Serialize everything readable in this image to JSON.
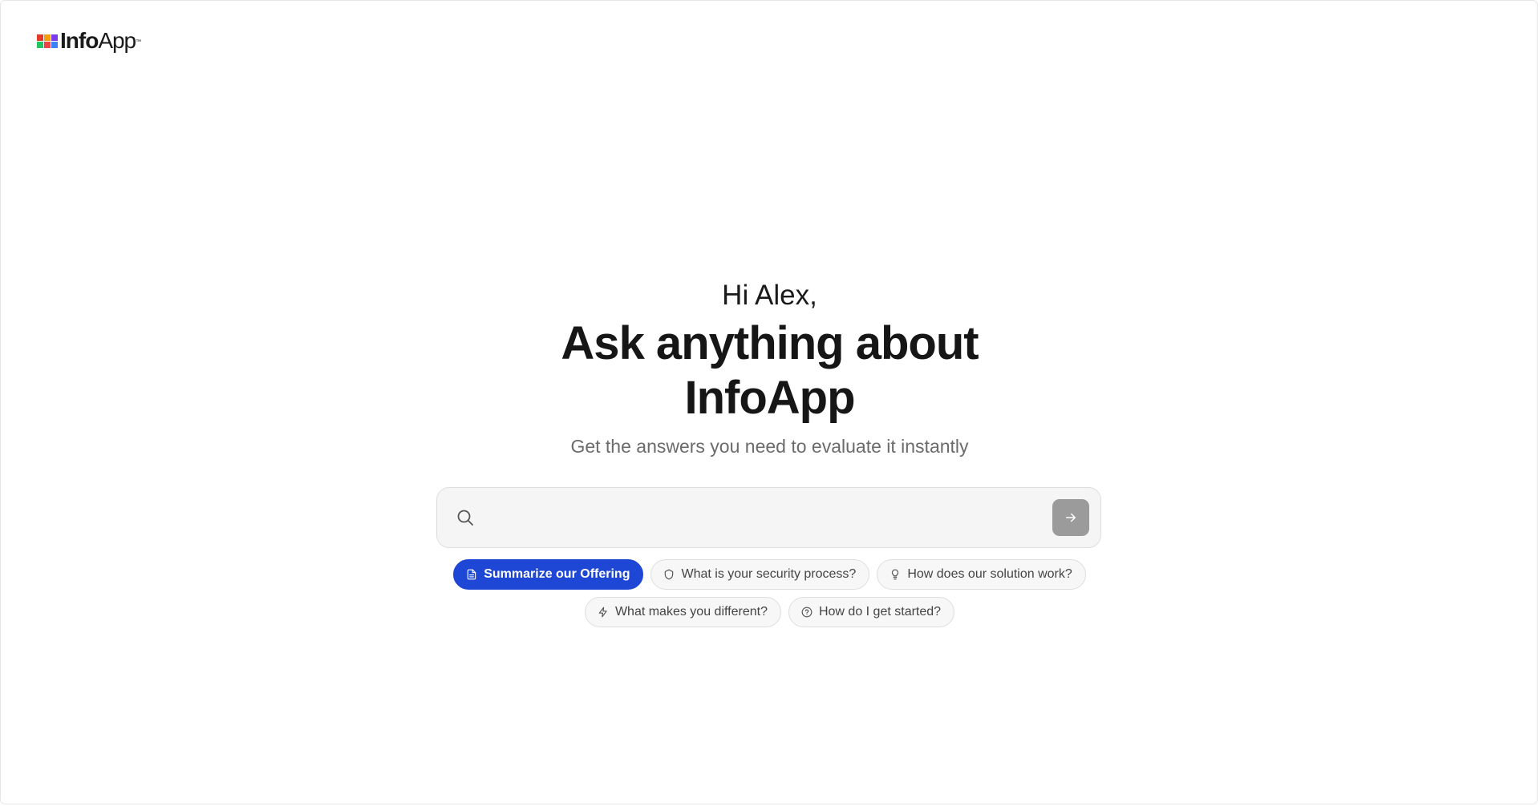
{
  "brand": {
    "name_bold": "Info",
    "name_light": "App",
    "trademark": "™",
    "square_colors": [
      "#e5392a",
      "#f59e0b",
      "#7c3aed",
      "#22c55e",
      "#ef4444",
      "#3b82f6"
    ]
  },
  "hero": {
    "greeting": "Hi Alex,",
    "headline_line1": "Ask anything about",
    "headline_line2": "InfoApp",
    "subheadline": "Get the answers you need to evaluate it instantly"
  },
  "search": {
    "placeholder": "",
    "value": "",
    "icon": "search-icon",
    "submit_icon": "arrow-right-icon"
  },
  "suggestions": {
    "row1": [
      {
        "label": "Summarize our Offering",
        "icon": "document-icon",
        "active": true
      },
      {
        "label": "What is your security process?",
        "icon": "shield-icon",
        "active": false
      },
      {
        "label": "How does our solution work?",
        "icon": "lightbulb-icon",
        "active": false
      }
    ],
    "row2": [
      {
        "label": "What makes you different?",
        "icon": "sparkle-icon",
        "active": false
      },
      {
        "label": "How do I get started?",
        "icon": "question-circle-icon",
        "active": false
      }
    ]
  },
  "colors": {
    "accent": "#1e47d6",
    "submit_button": "#9b9b9b",
    "search_bg": "#f5f5f5"
  }
}
